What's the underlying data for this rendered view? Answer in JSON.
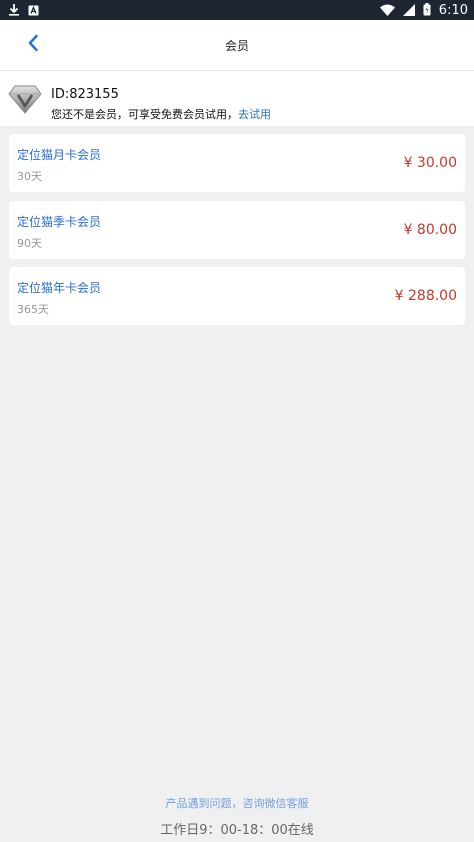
{
  "status_bar": {
    "time": "6:10",
    "icons": [
      "download-icon",
      "notification-a-icon",
      "wifi-icon",
      "signal-icon",
      "battery-icon"
    ]
  },
  "app_bar": {
    "title": "会员",
    "back_icon": "chevron-left-icon"
  },
  "member": {
    "badge_icon": "diamond-v-icon",
    "id_text": "ID:823155",
    "status_text": "您还不是会员，可享受免费会员试用，",
    "trial_link": "去试用"
  },
  "plans": [
    {
      "name": "定位猫月卡会员",
      "duration": "30天",
      "price": "¥ 30.00"
    },
    {
      "name": "定位猫季卡会员",
      "duration": "90天",
      "price": "¥ 80.00"
    },
    {
      "name": "定位猫年卡会员",
      "duration": "365天",
      "price": "¥ 288.00"
    }
  ],
  "footer": {
    "contact_text": "产品遇到问题，咨询微信客服",
    "hours_text": "工作日9：00-18：00在线"
  },
  "colors": {
    "status_bar_bg": "#1e2533",
    "accent": "#2a6fd6",
    "price": "#c0392b",
    "background": "#f0f0f0"
  }
}
